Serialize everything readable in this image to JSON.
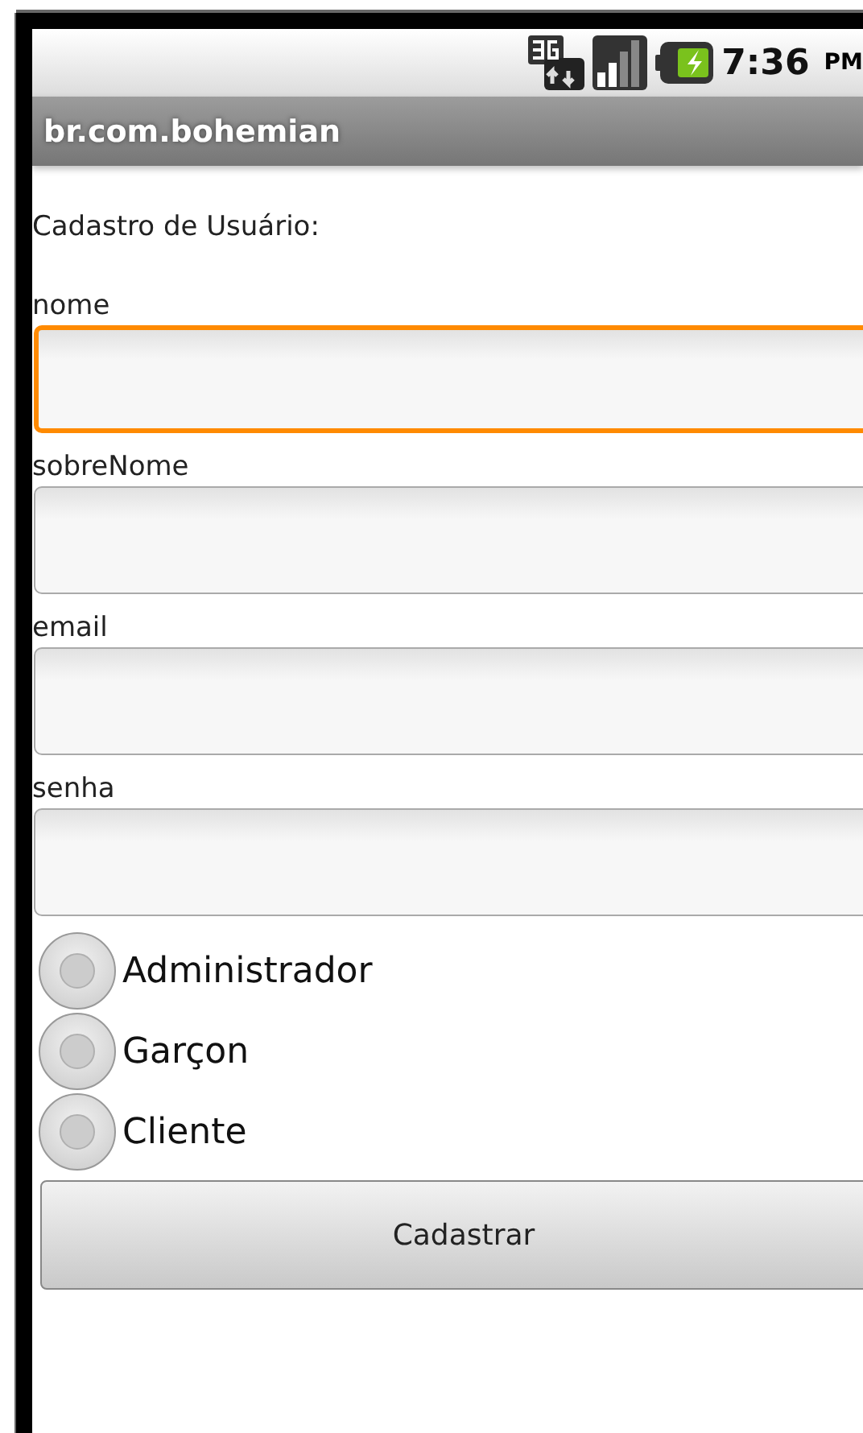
{
  "status_bar": {
    "time": "7:36",
    "period": "PM"
  },
  "title_bar": {
    "title": "br.com.bohemian"
  },
  "heading": "Cadastro de Usuário:",
  "fields": [
    {
      "label": "nome",
      "focused": true
    },
    {
      "label": "sobreNome",
      "focused": false
    },
    {
      "label": "email",
      "focused": false
    },
    {
      "label": "senha",
      "focused": false
    }
  ],
  "radios": [
    {
      "label": "Administrador",
      "selected": false
    },
    {
      "label": "Garçon",
      "selected": false
    },
    {
      "label": "Cliente",
      "selected": false
    }
  ],
  "buttons": [
    "Cadastrar"
  ]
}
